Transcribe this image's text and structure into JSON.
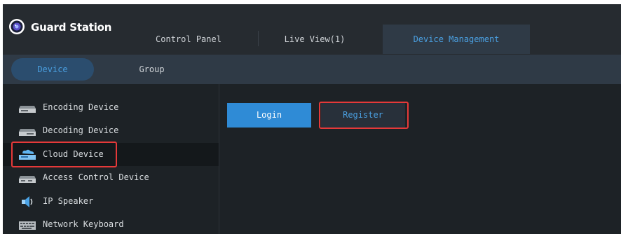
{
  "app": {
    "title": "Guard Station",
    "logo_icon": "camera-lens-icon",
    "accent_color": "#4a9fe0",
    "highlight_color": "#e53939"
  },
  "tabs": [
    {
      "label": "Control Panel",
      "active": false
    },
    {
      "label": "Live View(1)",
      "active": false
    },
    {
      "label": "Device Management",
      "active": true
    }
  ],
  "subtabs": [
    {
      "label": "Device",
      "active": true
    },
    {
      "label": "Group",
      "active": false
    }
  ],
  "sidebar": {
    "items": [
      {
        "label": "Encoding Device",
        "icon": "encoder-icon",
        "selected": false
      },
      {
        "label": "Decoding Device",
        "icon": "decoder-icon",
        "selected": false
      },
      {
        "label": "Cloud Device",
        "icon": "cloud-device-icon",
        "selected": true
      },
      {
        "label": "Access Control Device",
        "icon": "access-control-icon",
        "selected": false
      },
      {
        "label": "IP Speaker",
        "icon": "speaker-icon",
        "selected": false
      },
      {
        "label": "Network Keyboard",
        "icon": "keyboard-icon",
        "selected": false
      }
    ]
  },
  "actions": {
    "login_label": "Login",
    "register_label": "Register"
  }
}
